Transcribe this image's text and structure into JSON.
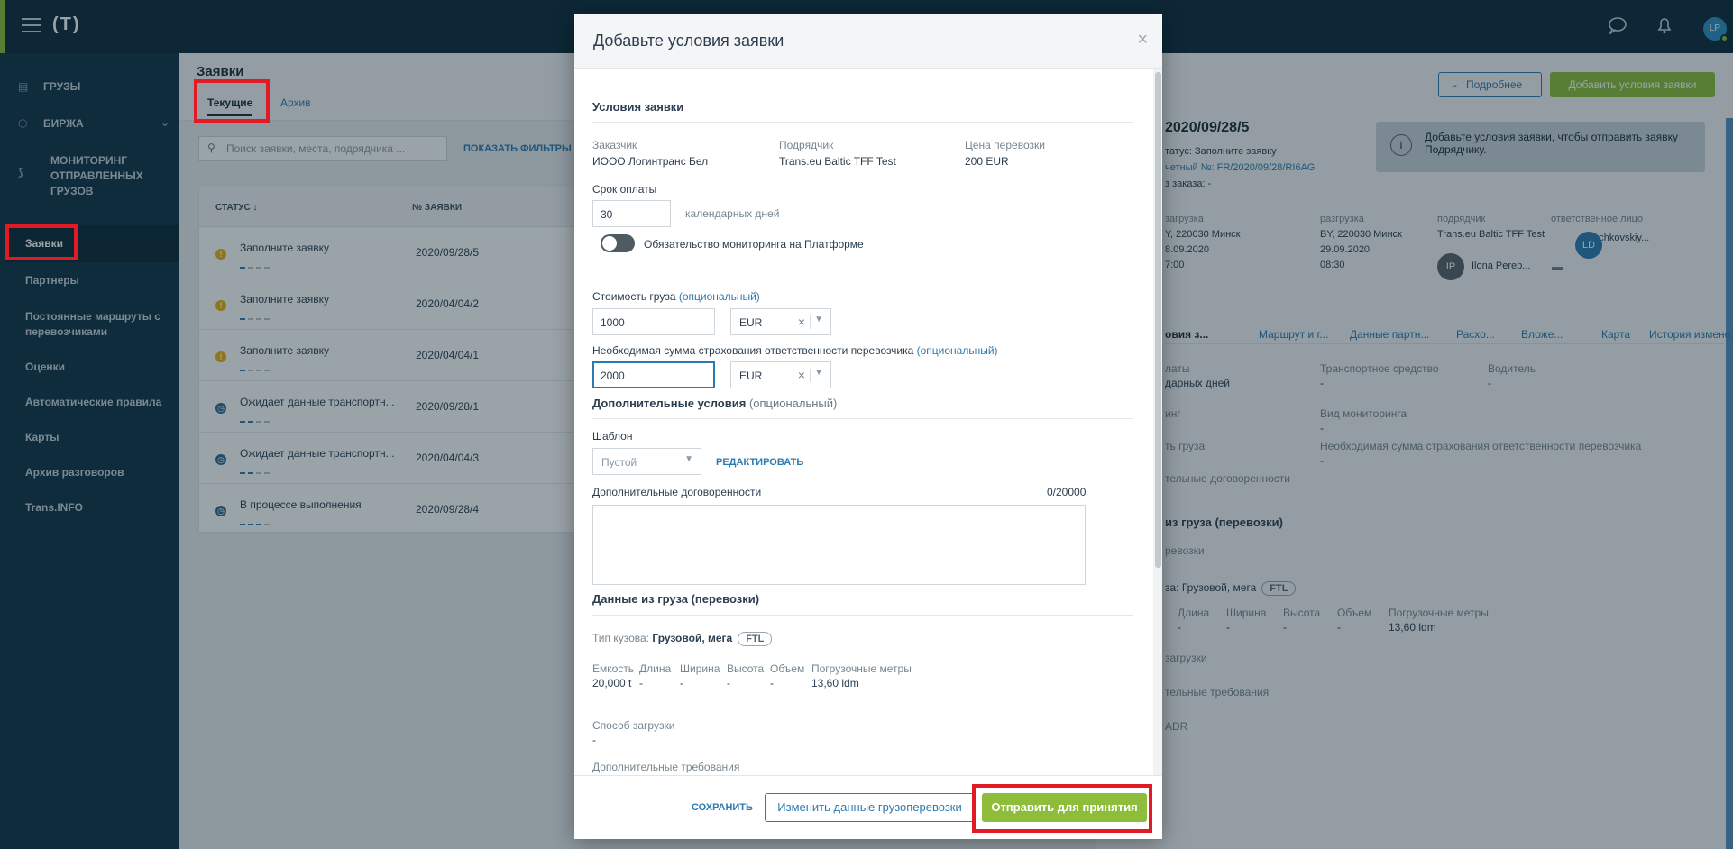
{
  "topbar": {
    "logo": "(T)",
    "avatar_initials": "LP"
  },
  "sidebar": {
    "top_items": [
      {
        "label": "ГРУЗЫ",
        "icon": "cargo-icon"
      },
      {
        "label": "БИРЖА",
        "icon": "exchange-icon"
      },
      {
        "label": "МОНИТОРИНГ ОТПРАВЛЕННЫХ ГРУЗОВ",
        "icon": "monitoring-icon"
      }
    ],
    "items": [
      {
        "label": "Заявки",
        "active": true
      },
      {
        "label": "Партнеры"
      },
      {
        "label": "Постоянные маршруты с перевозчиками"
      },
      {
        "label": "Оценки"
      },
      {
        "label": "Автоматические правила"
      },
      {
        "label": "Карты"
      },
      {
        "label": "Архив разговоров"
      },
      {
        "label": "Trans.INFO"
      }
    ]
  },
  "list": {
    "title": "Заявки",
    "tabs": [
      "Текущие",
      "Архив"
    ],
    "search_placeholder": "Поиск заявки, места, подрядчика ...",
    "filters_label": "ПОКАЗАТЬ ФИЛЬТРЫ",
    "columns": [
      "СТАТУС ↓",
      "№ ЗАЯВКИ"
    ],
    "rows": [
      {
        "status": "Заполните заявку",
        "number": "2020/09/28/5",
        "type": "warn",
        "progress": 1
      },
      {
        "status": "Заполните заявку",
        "number": "2020/04/04/2",
        "type": "warn",
        "progress": 1
      },
      {
        "status": "Заполните заявку",
        "number": "2020/04/04/1",
        "type": "warn",
        "progress": 1
      },
      {
        "status": "Ожидает данные транспортн...",
        "number": "2020/09/28/1",
        "type": "wait",
        "progress": 2
      },
      {
        "status": "Ожидает данные транспортн...",
        "number": "2020/04/04/3",
        "type": "wait",
        "progress": 2
      },
      {
        "status": "В процессе выполнения",
        "number": "2020/09/28/4",
        "type": "wait",
        "progress": 3
      }
    ]
  },
  "detail": {
    "more_btn": "Подробнее",
    "add_btn": "Добавить условия заявки",
    "title_frag": "2020/09/28/5",
    "status_frag": "татус: Заполните заявку",
    "account_frag": "четный №: FR/2020/09/28/RI6AG",
    "order_frag": "з заказа: -",
    "info_text": "Добавьте условия заявки, чтобы отправить заявку Подрядчику.",
    "cols": [
      {
        "label": "загрузка",
        "lines": [
          "Y, 220030 Минск",
          "8.09.2020",
          "7:00"
        ]
      },
      {
        "label": "разгрузка",
        "lines": [
          "BY, 220030 Минск",
          "29.09.2020",
          "08:30"
        ]
      },
      {
        "label": "подрядчик",
        "lines": [
          "Trans.eu Baltic TFF Test"
        ]
      },
      {
        "label": "ответственное лицо",
        "lines": [
          "Lychkovskiy..."
        ]
      }
    ],
    "person2": "Ilona Perep...",
    "person2_initials": "IP",
    "person1_initials": "LD",
    "tabs": [
      "овия з...",
      "Маршрут и г...",
      "Данные партн...",
      "Расхо...",
      "Вложе...",
      "Карта",
      "История измене..."
    ],
    "f_pay_label": "латы",
    "f_pay_val": "дарных дней",
    "f_vehicle_label": "Транспортное средство",
    "f_vehicle_val": "-",
    "f_driver_label": "Водитель",
    "f_driver_val": "-",
    "f_mon_label": "инг",
    "f_montype_label": "Вид мониторинга",
    "f_montype_val": "-",
    "f_cost_label": "ть груза",
    "f_ins_label": "Необходимая сумма страхования ответственности перевозчика",
    "f_ins_val": "-",
    "f_add_label": "тельные договоренности",
    "sec_cargo": "из груза (перевозки)",
    "sec_cargo_sub": "ревозки",
    "body_type": "за: Грузовой, мега",
    "body_pill": "FTL",
    "cargo_labels": [
      "Длина",
      "Ширина",
      "Высота",
      "Объем",
      "Погрузочные метры"
    ],
    "cargo_vals": [
      "-",
      "-",
      "-",
      "-",
      "13,60 ldm"
    ],
    "load_method": "загрузки",
    "extra_req": "тельные требования",
    "adr": "ADR"
  },
  "modal": {
    "title": "Добавьте условия заявки",
    "close_glyph": "×",
    "section1": "Условия заявки",
    "customer_label": "Заказчик",
    "customer_value": "ИООО Логинтранс Бел",
    "contractor_label": "Подрядчик",
    "contractor_value": "Trans.eu Baltic TFF Test",
    "price_label": "Цена перевозки",
    "price_value": "200 EUR",
    "payment_label": "Срок оплаты",
    "payment_value": "30",
    "payment_unit": "календарных дней",
    "monitoring_toggle_label": "Обязательство мониторинга на Платформе",
    "cargo_cost_label": "Стоимость груза",
    "optional": "(опциональный)",
    "cargo_cost_value": "1000",
    "cargo_cost_currency": "EUR",
    "insurance_label": "Необходимая сумма страхования ответственности перевозчика",
    "insurance_value": "2000",
    "insurance_currency": "EUR",
    "section2": "Дополнительные условия",
    "template_label": "Шаблон",
    "template_value": "Пустой",
    "edit_link": "РЕДАКТИРОВАТЬ",
    "agreements_label": "Дополнительные договоренности",
    "agreements_counter": "0/20000",
    "section3": "Данные из груза (перевозки)",
    "body_type_label": "Тип кузова:",
    "body_type_value": "Грузовой, мега",
    "body_type_pill": "FTL",
    "specs": [
      {
        "label": "Емкость",
        "value": "20,000 t"
      },
      {
        "label": "Длина",
        "value": "-"
      },
      {
        "label": "Ширина",
        "value": "-"
      },
      {
        "label": "Высота",
        "value": "-"
      },
      {
        "label": "Объем",
        "value": "-"
      },
      {
        "label": "Погрузочные метры",
        "value": "13,60 ldm"
      }
    ],
    "loading_method_label": "Способ загрузки",
    "loading_method_value": "-",
    "extra_req_label": "Дополнительные требования",
    "extra_req_value": "-",
    "save_btn": "СОХРАНИТЬ",
    "change_btn": "Изменить данные грузоперевозки",
    "send_btn": "Отправить для принятия"
  },
  "colors": {
    "accent": "#8dbd3a",
    "link": "#2d7ab0",
    "dark": "#0d2a3b",
    "highlight": "#e01b24"
  }
}
